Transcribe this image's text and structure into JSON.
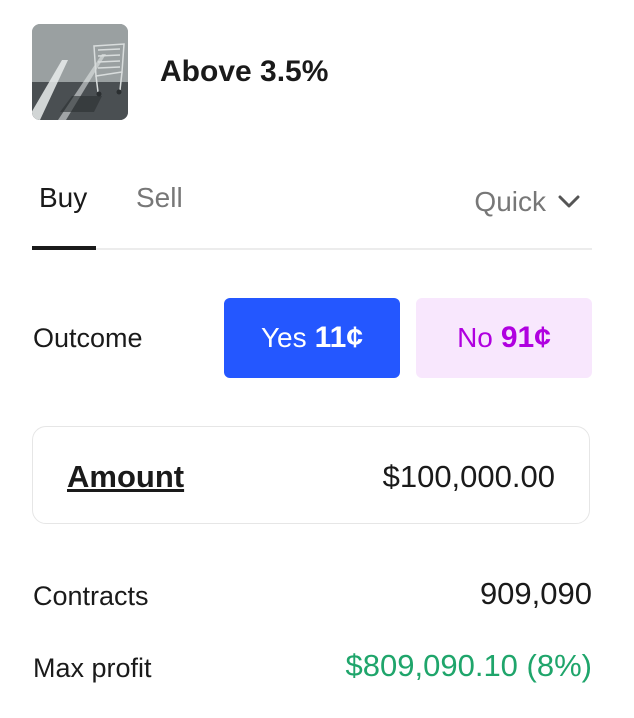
{
  "market": {
    "title": "Above 3.5%",
    "image": "shopping-cart-parking-lot-photo"
  },
  "tabs": {
    "buy": "Buy",
    "sell": "Sell",
    "active": "Buy",
    "order_type": "Quick",
    "order_type_icon": "chevron-down-icon"
  },
  "outcome": {
    "label": "Outcome",
    "yes_label": "Yes",
    "yes_price": "11¢",
    "no_label": "No",
    "no_price": "91¢",
    "selected": "Yes"
  },
  "amount": {
    "label": "Amount",
    "value": "$100,000.00"
  },
  "summary": {
    "contracts_label": "Contracts",
    "contracts_value": "909,090",
    "max_profit_label": "Max profit",
    "max_profit_value": "$809,090.10 (8%)"
  },
  "colors": {
    "yes_bg": "#2457ff",
    "no_bg": "#f8e7fd",
    "no_text": "#b000e0",
    "profit": "#1fa56b"
  }
}
